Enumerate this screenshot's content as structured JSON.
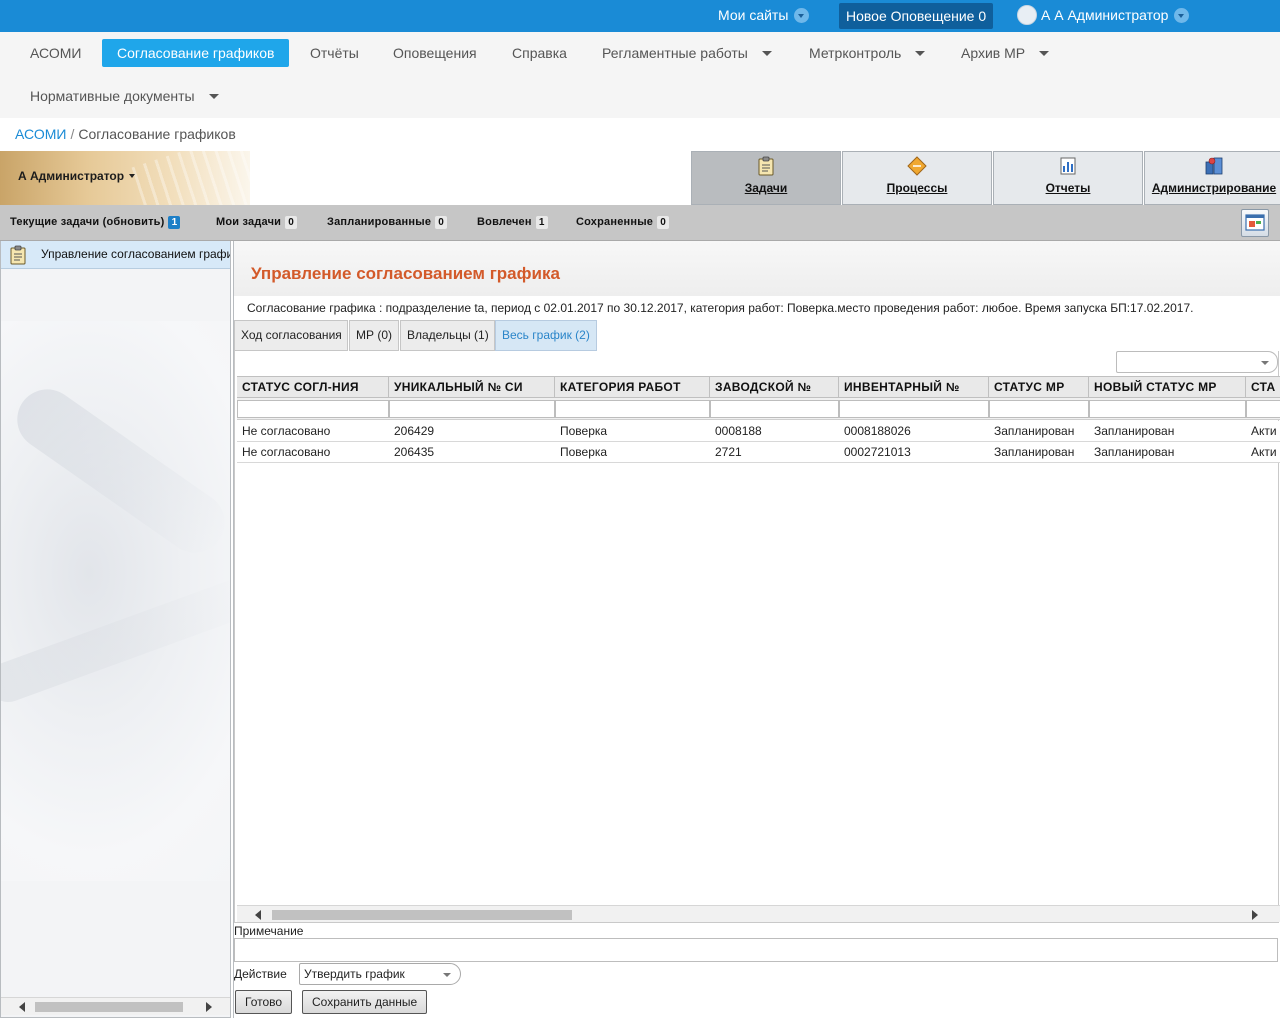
{
  "topbar": {
    "my_sites": "Мои сайты",
    "notification": "Новое Оповещение 0",
    "user": "А А Администратор"
  },
  "nav": {
    "items": [
      {
        "label": "АСОМИ"
      },
      {
        "label": "Согласование графиков",
        "active": true
      },
      {
        "label": "Отчёты"
      },
      {
        "label": "Оповещения"
      },
      {
        "label": "Справка"
      },
      {
        "label": "Регламентные работы",
        "dropdown": true
      },
      {
        "label": "Метрконтроль",
        "dropdown": true
      },
      {
        "label": "Архив МР",
        "dropdown": true
      },
      {
        "label": "Нормативные документы",
        "dropdown": true
      }
    ]
  },
  "breadcrumb": {
    "root": "АСОМИ",
    "sep": "/",
    "current": "Согласование графиков"
  },
  "userband": {
    "name": "А Администратор"
  },
  "bigtabs": [
    {
      "label": "Задачи",
      "icon": "clipboard-icon",
      "active": true
    },
    {
      "label": "Процессы",
      "icon": "diamond-icon"
    },
    {
      "label": "Отчеты",
      "icon": "bar-chart-icon"
    },
    {
      "label": "Администрирование",
      "icon": "admin-tools-icon"
    }
  ],
  "taskbar": {
    "current": {
      "label": "Текущие задачи (обновить)",
      "count": "1"
    },
    "mine": {
      "label": "Мои задачи",
      "count": "0"
    },
    "planned": {
      "label": "Запланированные",
      "count": "0"
    },
    "involved": {
      "label": "Вовлечен",
      "count": "1"
    },
    "saved": {
      "label": "Сохраненные",
      "count": "0"
    }
  },
  "leftpanel": {
    "selected": "Управление согласованием графика"
  },
  "main": {
    "title": "Управление согласованием графика",
    "description": "Согласование графика : подразделение ta, период с 02.01.2017 по 30.12.2017, категория работ: Поверка.место проведения работ: любое. Время запуска БП:17.02.2017.",
    "tabs": [
      {
        "label": "Ход согласования"
      },
      {
        "label": "МР (0)"
      },
      {
        "label": "Владельцы (1)"
      },
      {
        "label": "Весь график (2)",
        "active": true
      }
    ],
    "columns": [
      "СТАТУС СОГЛ-НИЯ",
      "УНИКАЛЬНЫЙ № СИ",
      "КАТЕГОРИЯ РАБОТ",
      "ЗАВОДСКОЙ №",
      "ИНВЕНТАРНЫЙ №",
      "СТАТУС МР",
      "НОВЫЙ СТАТУС МР",
      "СТА"
    ],
    "rows": [
      [
        "Не согласовано",
        "206429",
        "Поверка",
        "0008188",
        "0008188026",
        "Запланирован",
        "Запланирован",
        "Акти"
      ],
      [
        "Не согласовано",
        "206435",
        "Поверка",
        "2721",
        "0002721013",
        "Запланирован",
        "Запланирован",
        "Акти"
      ]
    ],
    "note_label": "Примечание",
    "action_label": "Действие",
    "action_value": "Утвердить график",
    "btn_done": "Готово",
    "btn_save": "Сохранить данные"
  },
  "colors": {
    "accent": "#1a8bd6",
    "active_nav": "#1fa6ea",
    "title": "#d35a2a"
  }
}
